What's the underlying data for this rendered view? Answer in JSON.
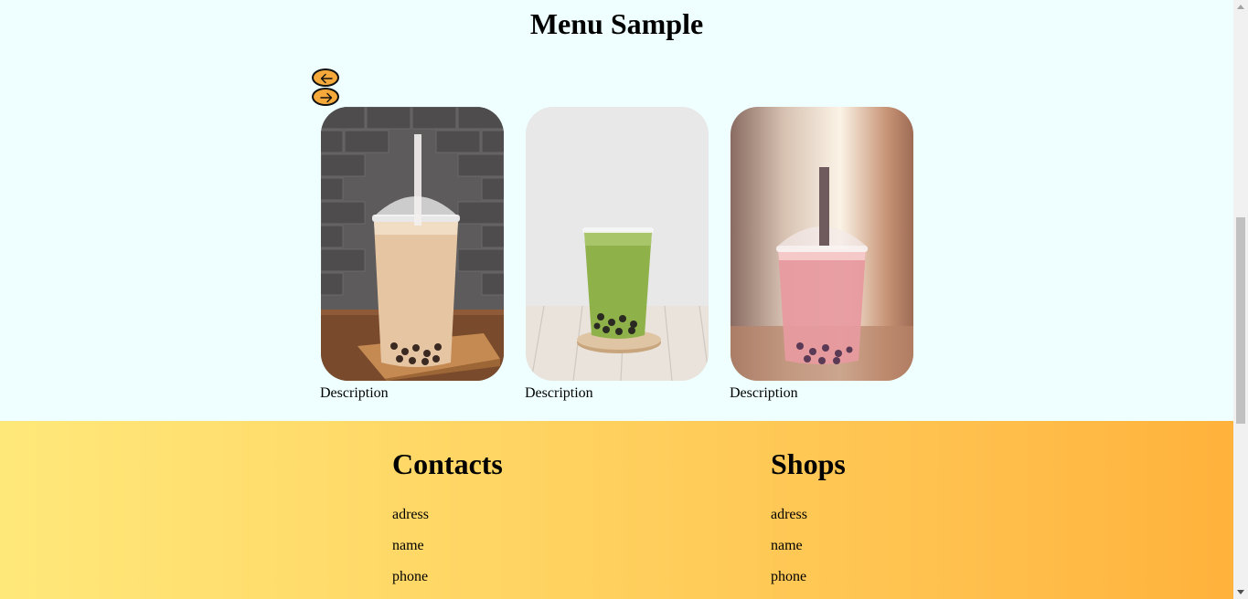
{
  "page": {
    "title": "Menu Sample"
  },
  "slider": {
    "prev_icon": "arrow-left-icon",
    "next_icon": "arrow-right-icon",
    "button_color": "#f5a93a",
    "cards": [
      {
        "description": "Description",
        "image": "milk-bubble-tea-photo"
      },
      {
        "description": "Description",
        "image": "matcha-bubble-tea-photo"
      },
      {
        "description": "Description",
        "image": "strawberry-bubble-tea-photo"
      }
    ]
  },
  "footer": {
    "gradient": [
      "#ffe87a",
      "#ffb23c"
    ],
    "contacts": {
      "title": "Contacts",
      "items": [
        "adress",
        "name",
        "phone"
      ]
    },
    "shops": {
      "title": "Shops",
      "items": [
        "adress",
        "name",
        "phone"
      ]
    }
  }
}
